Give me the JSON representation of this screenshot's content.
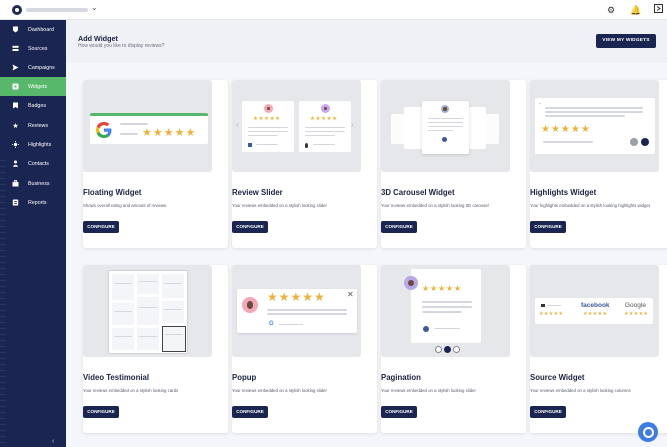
{
  "topbar": {
    "settings_icon": "gear-icon",
    "notification_icon": "bell-icon",
    "exit_icon": "logout-icon"
  },
  "sidebar": {
    "items": [
      {
        "label": "Dashboard",
        "icon": "dashboard-icon"
      },
      {
        "label": "Sources",
        "icon": "sources-icon"
      },
      {
        "label": "Campaigns",
        "icon": "send-icon"
      },
      {
        "label": "Widgets",
        "icon": "widget-icon",
        "active": true
      },
      {
        "label": "Badges",
        "icon": "badge-icon"
      },
      {
        "label": "Reviews",
        "icon": "star-icon"
      },
      {
        "label": "Highlights",
        "icon": "highlight-icon"
      },
      {
        "label": "Contacts",
        "icon": "contacts-icon"
      },
      {
        "label": "Business",
        "icon": "business-icon"
      },
      {
        "label": "Reports",
        "icon": "reports-icon"
      }
    ]
  },
  "header": {
    "title": "Add Widget",
    "subtitle": "How would you like to display reviews?",
    "view_button": "VIEW MY WIDGETS"
  },
  "widgets": [
    {
      "title": "Floating Widget",
      "desc": "Shows overall rating and amount of reviews.",
      "button": "CONFIGURE"
    },
    {
      "title": "Review Slider",
      "desc": "Your reviews embedded on a stylish looking slider",
      "button": "CONFIGURE"
    },
    {
      "title": "3D Carousel Widget",
      "desc": "Your reviews embedded on a stylish looking 3D carousel",
      "button": "CONFIGURE"
    },
    {
      "title": "Highlights Widget",
      "desc": "Your highlights embedded on a stylish looking highlights widget",
      "button": "CONFIGURE"
    },
    {
      "title": "Video Testimonial",
      "desc": "Your reviews embedded on a stylish looking cards",
      "button": "CONFIGURE"
    },
    {
      "title": "Popup",
      "desc": "Your reviews embedded on a stylish looking slider",
      "button": "CONFIGURE"
    },
    {
      "title": "Pagination",
      "desc": "Your reviews embedded on a stylish looking slider",
      "button": "CONFIGURE"
    },
    {
      "title": "Source Widget",
      "desc": "Your reviews embedded on a stylish looking columns",
      "button": "CONFIGURE"
    }
  ],
  "preview_text": {
    "star_string": "★★★★★",
    "facebook": "facebook",
    "google": "Google"
  },
  "colors": {
    "sidebar": "#1b2551",
    "active": "#57b86c",
    "star": "#f0b13a",
    "button": "#1b2551",
    "chat": "#3d7ce6"
  }
}
